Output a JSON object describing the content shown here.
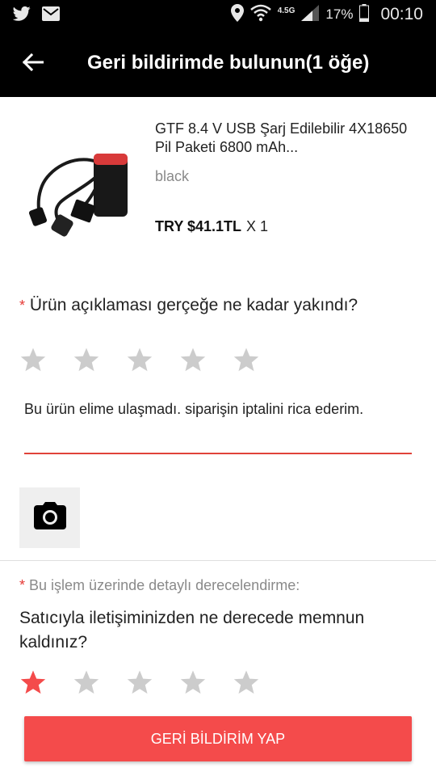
{
  "status_bar": {
    "network": "4.5G",
    "battery": "17%",
    "time": "00:10"
  },
  "header": {
    "title": "Geri bildirimde bulunun(1 öğe)"
  },
  "product": {
    "title": "GTF 8.4 V USB Şarj Edilebilir 4X18650 Pil Paketi 6800 mAh...",
    "variant": "black",
    "price": "TRY $41.1TL",
    "quantity": "X 1"
  },
  "rating_accuracy": {
    "required_mark": "*",
    "question": "Ürün açıklaması gerçeğe ne kadar yakındı?",
    "stars_selected": 0,
    "stars_total": 5
  },
  "review": {
    "text": "Bu ürün elime ulaşmadı. siparişin iptalini rica ederim."
  },
  "seller_rating": {
    "required_mark": "*",
    "hint": "Bu işlem üzerinde detaylı derecelendirme:",
    "question": "Satıcıyla iletişiminizden ne derecede memnun kaldınız?",
    "stars_selected": 1,
    "stars_total": 5
  },
  "submit": {
    "label": "GERİ BİLDİRİM YAP"
  },
  "colors": {
    "accent": "#f44b4b",
    "star_active": "#f44b4b",
    "star_inactive": "#cccccc"
  }
}
